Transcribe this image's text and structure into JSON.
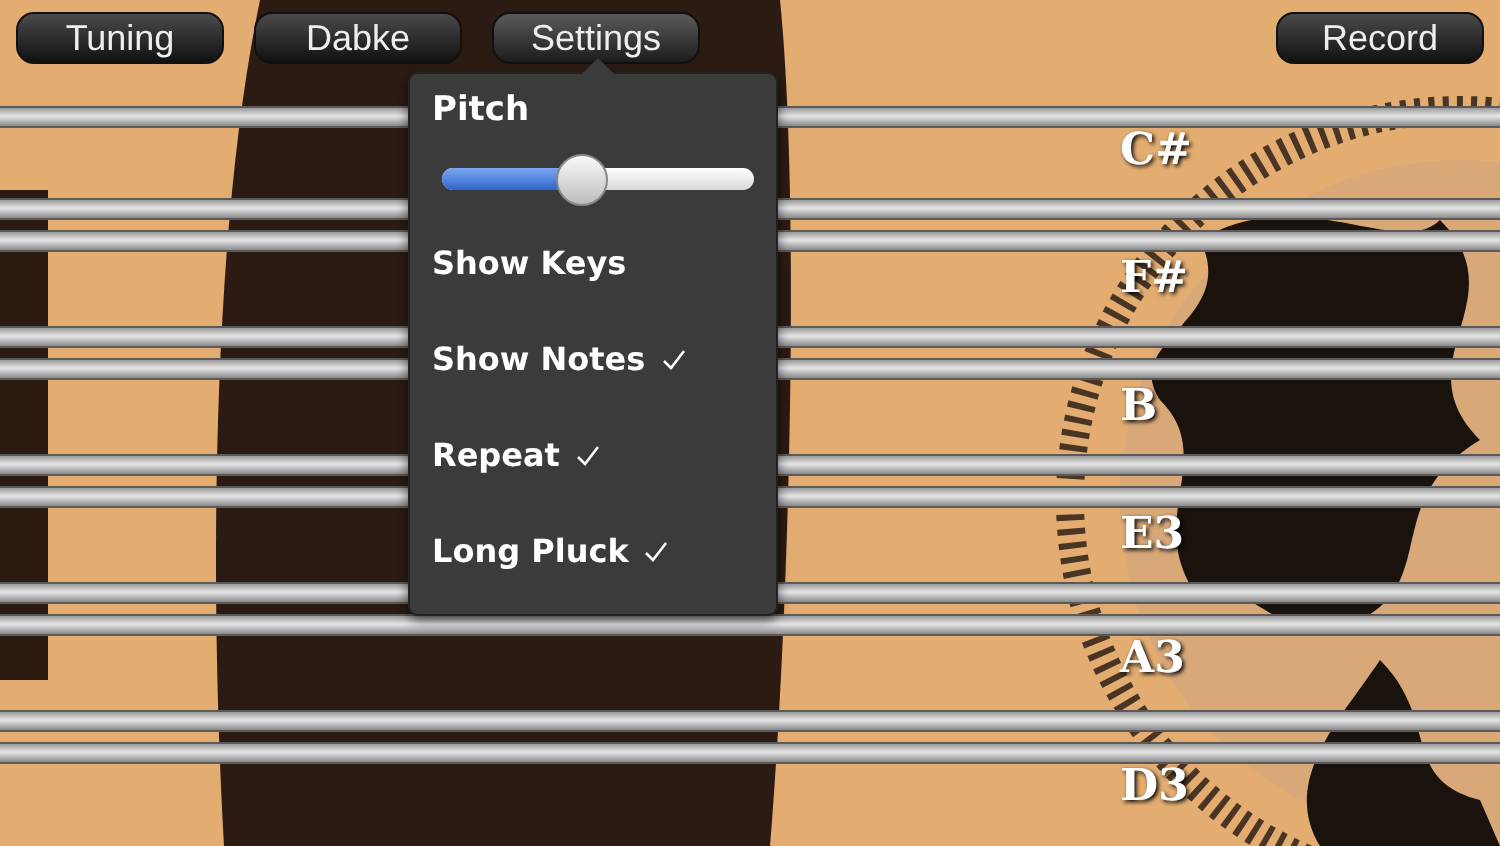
{
  "toolbar": {
    "buttons": [
      {
        "label": "Tuning",
        "selected": false
      },
      {
        "label": "Dabke",
        "selected": false
      },
      {
        "label": "Settings",
        "selected": true
      }
    ],
    "record": {
      "label": "Record"
    }
  },
  "settings_popover": {
    "title": "Pitch",
    "pitch": {
      "level": 0.45
    },
    "options": [
      {
        "label": "Show Keys",
        "checked": false
      },
      {
        "label": "Show Notes",
        "checked": true
      },
      {
        "label": "Repeat",
        "checked": true
      },
      {
        "label": "Long Pluck",
        "checked": true
      }
    ]
  },
  "notes": [
    "C#",
    "F#",
    "B",
    "E3",
    "A3",
    "D3"
  ]
}
